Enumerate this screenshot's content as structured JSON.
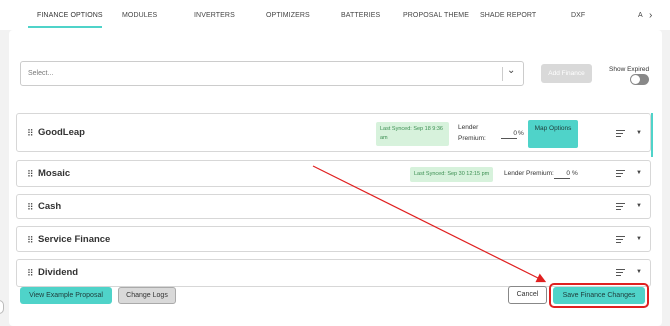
{
  "tabs": [
    {
      "label": "FINANCE OPTIONS",
      "active": true
    },
    {
      "label": "MODULES"
    },
    {
      "label": "INVERTERS"
    },
    {
      "label": "OPTIMIZERS"
    },
    {
      "label": "BATTERIES"
    },
    {
      "label": "PROPOSAL THEME"
    },
    {
      "label": "SHADE REPORT"
    },
    {
      "label": "DXF"
    },
    {
      "label": "A"
    }
  ],
  "toolbar": {
    "select_placeholder": "Select...",
    "add_finance_label": "Add Finance",
    "show_expired_label": "Show Expired",
    "show_expired_on": false
  },
  "finance_rows": [
    {
      "name": "GoodLeap",
      "sync": "Last Synced: Sep 18 9:36 am",
      "lender_label": "Lender Premium:",
      "premium": "0",
      "percent": "%",
      "map_label": "Map Options"
    },
    {
      "name": "Mosaic",
      "sync": "Last Synced: Sep 30 12:15 pm",
      "lender_label": "Lender Premium:",
      "premium": "0",
      "percent": "%"
    },
    {
      "name": "Cash"
    },
    {
      "name": "Service Finance"
    },
    {
      "name": "Dividend"
    }
  ],
  "footer": {
    "view_example_label": "View Example Proposal",
    "change_logs_label": "Change Logs",
    "cancel_label": "Cancel",
    "save_label": "Save Finance Changes"
  },
  "colors": {
    "accent": "#4fd3c9",
    "sync_badge_bg": "#d7f2dc",
    "annotation_red": "#e02020"
  }
}
